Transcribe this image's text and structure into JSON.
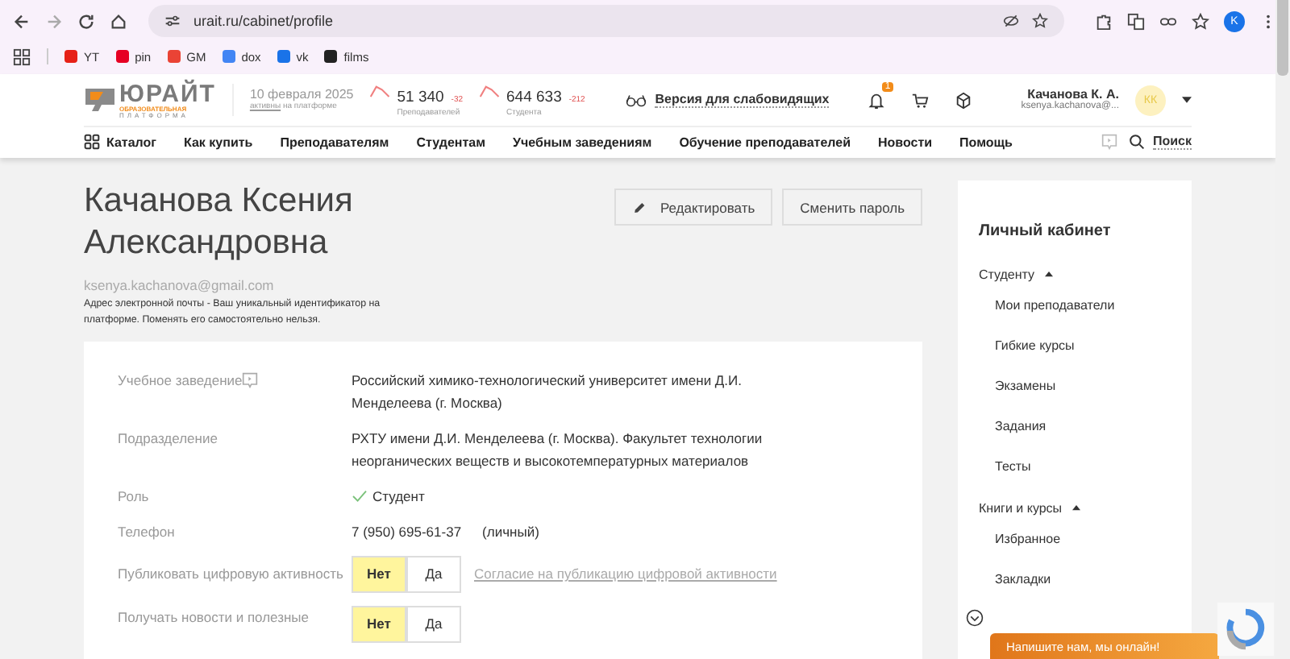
{
  "browser": {
    "url": "urait.ru/cabinet/profile",
    "profile_initial": "K",
    "bookmarks": [
      {
        "label": "YT",
        "color": "#e62117"
      },
      {
        "label": "pin",
        "color": "#e60023"
      },
      {
        "label": "GM",
        "color": "#ea4335"
      },
      {
        "label": "dox",
        "color": "#4285f4"
      },
      {
        "label": "vk",
        "color": "#1a73e8"
      },
      {
        "label": "films",
        "color": "#222222"
      }
    ]
  },
  "header": {
    "logo": {
      "name": "ЮРАЙТ",
      "tagline_1": "ОБРАЗОВАТЕЛЬНАЯ",
      "tagline_2": "ПЛАТФОРМА"
    },
    "date": "10 февраля 2025",
    "date_note_link": "активны",
    "date_note": "на платформе",
    "stats": [
      {
        "value": "51 340",
        "delta": "-32",
        "label": "Преподавателей"
      },
      {
        "value": "644 633",
        "delta": "-212",
        "label": "Студента"
      }
    ],
    "accessibility": "Версия для слабовидящих",
    "notifications": "1",
    "user": {
      "name": "Качанова К. А.",
      "email": "ksenya.kachanova@...",
      "initials": "КК"
    },
    "nav": [
      "Каталог",
      "Как купить",
      "Преподавателям",
      "Студентам",
      "Учебным заведениям",
      "Обучение преподавателей",
      "Новости",
      "Помощь"
    ],
    "search": "Поиск"
  },
  "profile": {
    "name": "Качанова Ксения Александровна",
    "buttons": [
      {
        "label": "Редактировать",
        "icon": true
      },
      {
        "label": "Сменить пароль",
        "icon": false
      }
    ],
    "email": "ksenya.kachanova@gmail.com",
    "email_note": "Адрес электронной почты - Ваш уникальный идентификатор на платформе. Поменять его самостоятельно нельзя."
  },
  "fields": [
    {
      "kind": "text",
      "label": "Учебное заведение",
      "value": "Российский химико-технологический университет имени Д.И. Менделеева (г. Москва)"
    },
    {
      "kind": "text",
      "label": "Подразделение",
      "value": "РХТУ имени Д.И. Менделеева (г. Москва). Факультет технологии неорганических веществ и высокотемпературных материалов"
    },
    {
      "kind": "role",
      "label": "Роль",
      "value": "Студент"
    },
    {
      "kind": "phone",
      "label": "Телефон",
      "value": "7 (950) 695-61-37",
      "note": "(личный)"
    },
    {
      "kind": "toggle",
      "label": "Публиковать цифровую активность",
      "options": [
        {
          "label": "Нет",
          "selected": true
        },
        {
          "label": "Да",
          "selected": false
        }
      ],
      "link": "Согласие на публикацию цифровой активности"
    },
    {
      "kind": "toggle",
      "label": "Получать новости и полезные",
      "options": [
        {
          "label": "Нет",
          "selected": true
        },
        {
          "label": "Да",
          "selected": false
        }
      ]
    }
  ],
  "sidebar": {
    "title": "Личный кабинет",
    "groups": [
      {
        "label": "Студенту",
        "expanded": true,
        "items": [
          "Мои преподаватели",
          "Гибкие курсы",
          "Экзамены",
          "Задания",
          "Тесты"
        ]
      },
      {
        "label": "Книги и курсы",
        "expanded": true,
        "items": [
          "Избранное",
          "Закладки"
        ]
      }
    ]
  },
  "chat": "Напишите нам, мы онлайн!"
}
